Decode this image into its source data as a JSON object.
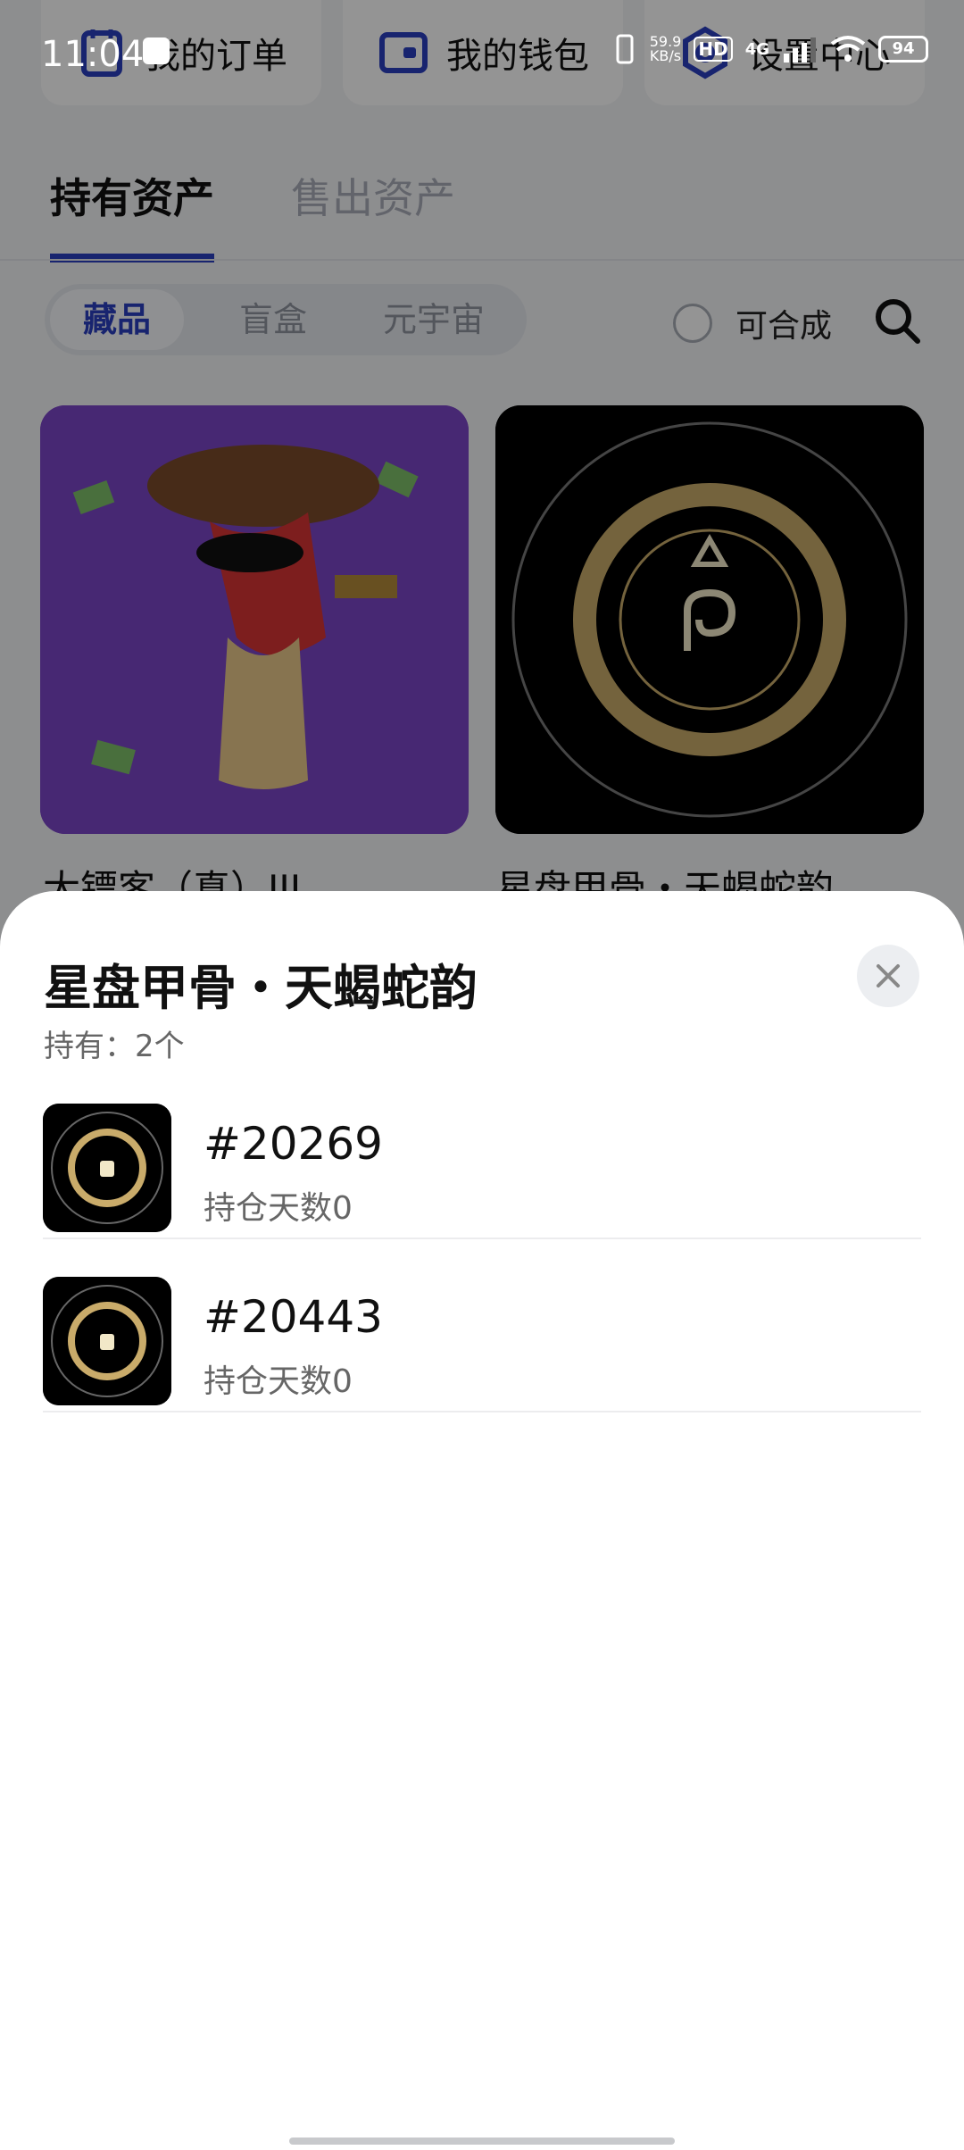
{
  "status_bar": {
    "time": "11:04",
    "net_speed_value": "59.9",
    "net_speed_unit": "KB/s",
    "hd": "HD",
    "network": "4G",
    "battery": "94"
  },
  "quick_menu": [
    {
      "label": "我的订单",
      "icon": "order-icon"
    },
    {
      "label": "我的钱包",
      "icon": "wallet-icon"
    },
    {
      "label": "设置中心",
      "icon": "settings-icon"
    }
  ],
  "asset_tabs": [
    {
      "label": "持有资产",
      "active": true
    },
    {
      "label": "售出资产",
      "active": false
    }
  ],
  "filter": {
    "options": [
      "藏品",
      "盲盒",
      "元宇宙"
    ],
    "selected": "藏品",
    "mergeable_label": "可合成"
  },
  "collection_cards": [
    {
      "title": "大镖客（真）III"
    },
    {
      "title": "星盘甲骨・天蝎蛇韵"
    }
  ],
  "sheet": {
    "title": "星盘甲骨・天蝎蛇韵",
    "holding": "持有：2个",
    "items": [
      {
        "id": "#20269",
        "days": "持仓天数0"
      },
      {
        "id": "#20443",
        "days": "持仓天数0"
      }
    ]
  },
  "colors": {
    "accent": "#2a3fc0",
    "overlay": "#000000"
  }
}
